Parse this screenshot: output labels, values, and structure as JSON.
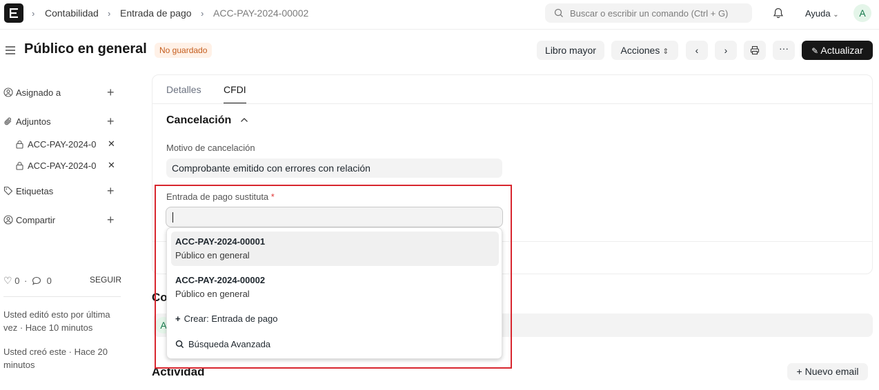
{
  "navbar": {
    "logo_letter": "E",
    "breadcrumbs": [
      "Contabilidad",
      "Entrada de pago",
      "ACC-PAY-2024-00002"
    ],
    "breadcrumb_separator": ">",
    "search_placeholder": "Buscar o escribir un comando (Ctrl + G)",
    "help_label": "Ayuda",
    "avatar_letter": "A"
  },
  "header": {
    "title": "Público en general",
    "status_badge": "No guardado",
    "buttons": {
      "ledger": "Libro mayor",
      "actions": "Acciones",
      "more": "···",
      "update": "Actualizar"
    }
  },
  "sidebar": {
    "assigned_to": "Asignado a",
    "attachments": "Adjuntos",
    "attachment_files": [
      "ACC-PAY-2024-0",
      "ACC-PAY-2024-0"
    ],
    "tags": "Etiquetas",
    "share": "Compartir",
    "likes": "0",
    "comments": "0",
    "follow": "SEGUIR",
    "edited_note": "Usted editó esto por última vez · Hace 10 minutos",
    "created_note": "Usted creó este · Hace 20 minutos"
  },
  "form": {
    "tabs": [
      "Detalles",
      "CFDI"
    ],
    "active_tab": "CFDI",
    "section_title": "Cancelación",
    "cancel_reason_label": "Motivo de cancelación",
    "cancel_reason_value": "Comprobante emitido con errores con relación",
    "substitute_label": "Entrada de pago sustituta",
    "required_mark": "*",
    "substitute_value": ""
  },
  "dropdown": {
    "options": [
      {
        "title": "ACC-PAY-2024-00001",
        "subtitle": "Público en general"
      },
      {
        "title": "ACC-PAY-2024-00002",
        "subtitle": "Público en general"
      }
    ],
    "create_label": "Crear: Entrada de pago",
    "advanced_search_label": "Búsqueda Avanzada"
  },
  "below": {
    "comments_heading_partial": "Co",
    "comment_avatar_letter": "A",
    "activity_heading": "Actividad",
    "new_email": "+ Nuevo email"
  },
  "colors": {
    "primary_dark": "#171717",
    "badge_bg": "#fff1e7",
    "badge_text": "#c45c1c",
    "highlight_box": "#d8262e"
  }
}
